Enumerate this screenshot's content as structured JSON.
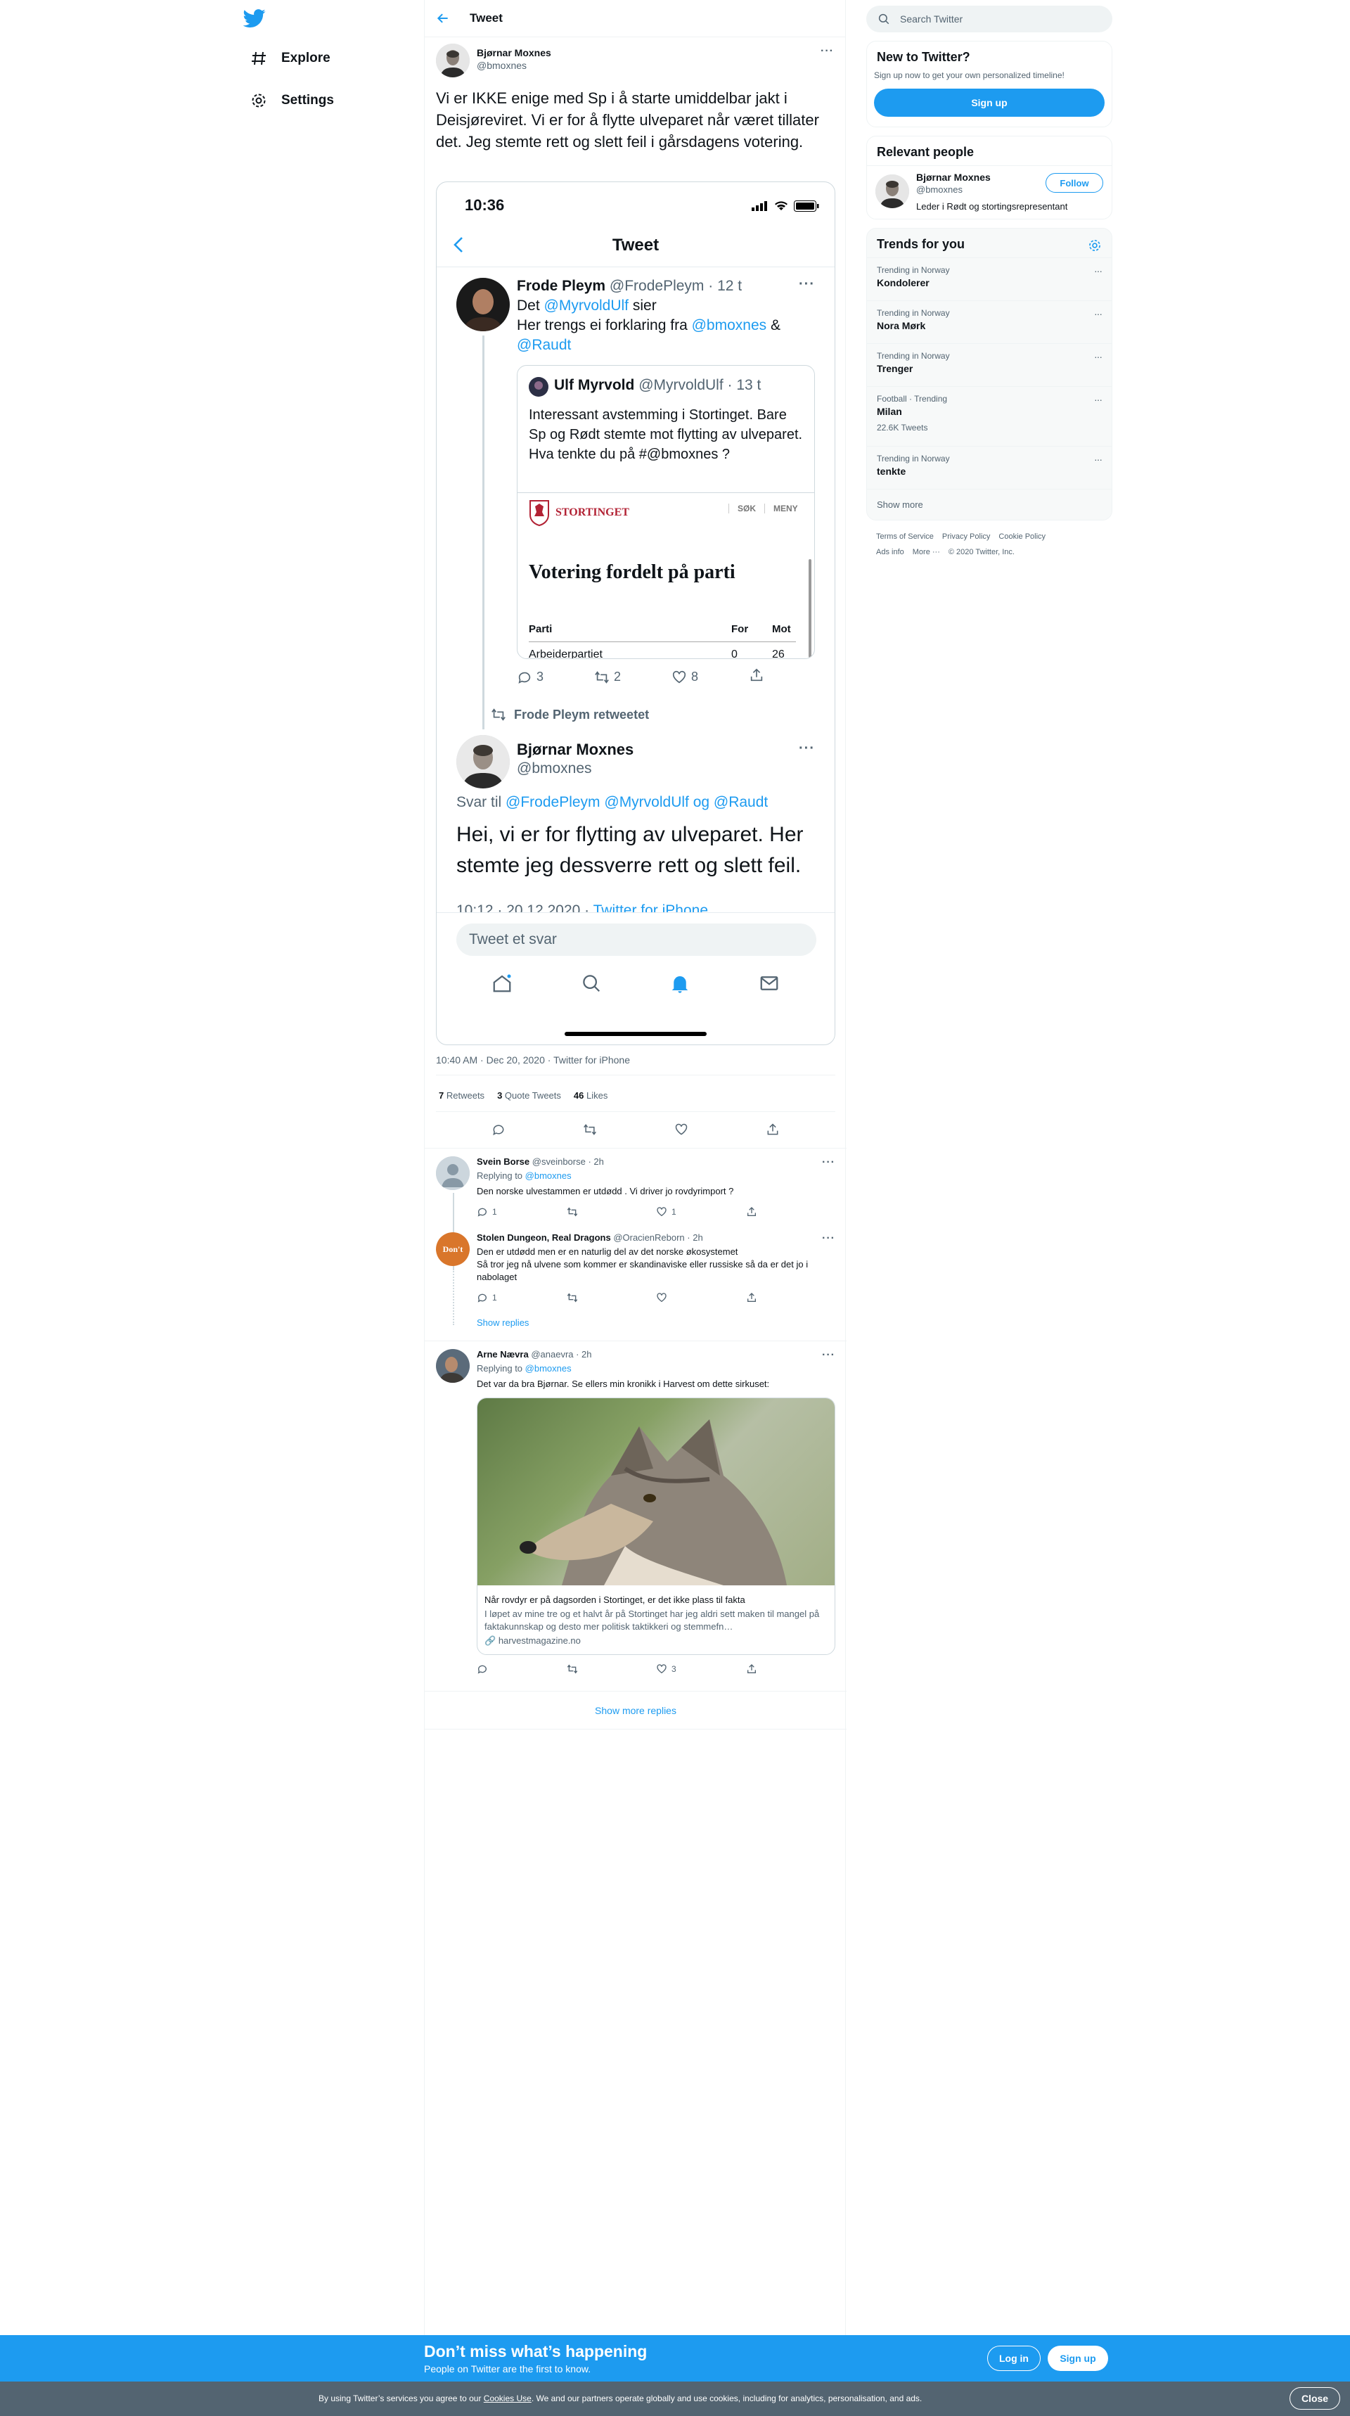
{
  "nav": {
    "explore": "Explore",
    "settings": "Settings"
  },
  "header": {
    "title": "Tweet"
  },
  "tweet": {
    "name": "Bjørnar Moxnes",
    "handle": "@bmoxnes",
    "text": "Vi er IKKE enige med Sp i å starte umiddelbar jakt i Deisjøreviret. Vi er for å flytte ulveparet når været tillater det. Jeg stemte rett og slett feil i gårsdagens votering.",
    "timestamp": "10:40 AM · Dec 20, 2020 · Twitter for iPhone",
    "retweets_count": "7",
    "retweets_label": "Retweets",
    "quotes_count": "3",
    "quotes_label": "Quote Tweets",
    "likes_count": "46",
    "likes_label": "Likes"
  },
  "phone": {
    "time": "10:36",
    "title": "Tweet",
    "t1": {
      "name": "Frode Pleym",
      "meta": "@FrodePleym · 12 t",
      "l1a": "Det ",
      "l1m": "@MyrvoldUlf",
      "l1b": " sier",
      "l2a": "Her trengs ei forklaring fra ",
      "l2m": "@bmoxnes",
      "l2b": " &",
      "l3m": "@Raudt"
    },
    "quote": {
      "name": "Ulf Myrvold",
      "meta": "@MyrvoldUlf · 13 t",
      "text": "Interessant avstemming i Stortinget. Bare Sp og Rødt stemte mot flytting av ulveparet. Hva tenkte du på #@bmoxnes ?",
      "brand": "STORTINGET",
      "sok": "SØK",
      "meny": "MENY",
      "heading": "Votering fordelt på parti",
      "col_parti": "Parti",
      "col_for": "For",
      "col_mot": "Mot",
      "row_party": "Arbeiderpartiet",
      "row_for": "0",
      "row_mot": "26"
    },
    "t1_actions": {
      "replies": "3",
      "retweets": "2",
      "likes": "8"
    },
    "retweeted": "Frode Pleym retweetet",
    "t2": {
      "name": "Bjørnar Moxnes",
      "handle": "@bmoxnes",
      "reply_prefix": "Svar til ",
      "reply_to": "@FrodePleym @MyrvoldUlf og @Raudt",
      "text": "Hei, vi er for flytting av ulveparet. Her stemte jeg dessverre rett og slett feil.",
      "time": "10:12 · 20.12.2020 · ",
      "source": "Twitter for iPhone"
    },
    "reply_placeholder": "Tweet et svar"
  },
  "replies": [
    {
      "name": "Svein Borse",
      "meta": "@sveinborse · 2h",
      "replying": "Replying to ",
      "to": "@bmoxnes",
      "text": "Den norske ulvestammen er utdødd . Vi driver jo rovdyrimport ?",
      "reply_count": "1",
      "like_count": "1"
    },
    {
      "name": "Stolen Dungeon, Real Dragons",
      "meta": "@OracienReborn · 2h",
      "text1": "Den er utdødd men er en naturlig del av det norske økosystemet",
      "text2": "Så tror jeg nå ulvene som kommer er skandinaviske eller russiske så da er det jo i nabolaget",
      "reply_count": "1",
      "avatar_text": "Don't"
    },
    {
      "name": "Arne Nævra",
      "meta": "@anaevra · 2h",
      "replying": "Replying to ",
      "to": "@bmoxnes",
      "text": "Det var da bra Bjørnar. Se ellers min kronikk i Harvest om dette sirkuset:",
      "card_title": "Når rovdyr er på dagsorden i Stortinget, er det ikke plass til fakta",
      "card_desc": "I løpet av mine tre og et halvt år på Stortinget har jeg aldri sett maken til mangel på faktakunnskap og desto mer politisk taktikkeri og stemmefn…",
      "card_domain": "harvestmagazine.no",
      "like_count": "3"
    }
  ],
  "show_replies": "Show replies",
  "show_more_replies": "Show more replies",
  "search": {
    "placeholder": "Search Twitter"
  },
  "new_to_twitter": {
    "title": "New to Twitter?",
    "subtitle": "Sign up now to get your own personalized timeline!",
    "signup": "Sign up"
  },
  "relevant": {
    "title": "Relevant people",
    "name": "Bjørnar Moxnes",
    "handle": "@bmoxnes",
    "follow": "Follow",
    "bio": "Leder i Rødt og stortingsrepresentant"
  },
  "trends": {
    "title": "Trends for you",
    "items": [
      {
        "context": "Trending in Norway",
        "name": "Kondolerer",
        "count": ""
      },
      {
        "context": "Trending in Norway",
        "name": "Nora Mørk",
        "count": ""
      },
      {
        "context": "Trending in Norway",
        "name": "Trenger",
        "count": ""
      },
      {
        "context": "Football · Trending",
        "name": "Milan",
        "count": "22.6K Tweets"
      },
      {
        "context": "Trending in Norway",
        "name": "tenkte",
        "count": ""
      }
    ],
    "show_more": "Show more"
  },
  "footer": {
    "terms": "Terms of Service",
    "privacy": "Privacy Policy",
    "cookie": "Cookie Policy",
    "ads": "Ads info",
    "more": "More ···",
    "copyright": "© 2020 Twitter, Inc."
  },
  "banner": {
    "title": "Don’t miss what’s happening",
    "subtitle": "People on Twitter are the first to know.",
    "login": "Log in",
    "signup": "Sign up"
  },
  "cookies": {
    "pre": "By using Twitter’s services you agree to our ",
    "link": "Cookies Use",
    "post": ". We and our partners operate globally and use cookies, including for analytics, personalisation, and ads.",
    "close": "Close"
  }
}
